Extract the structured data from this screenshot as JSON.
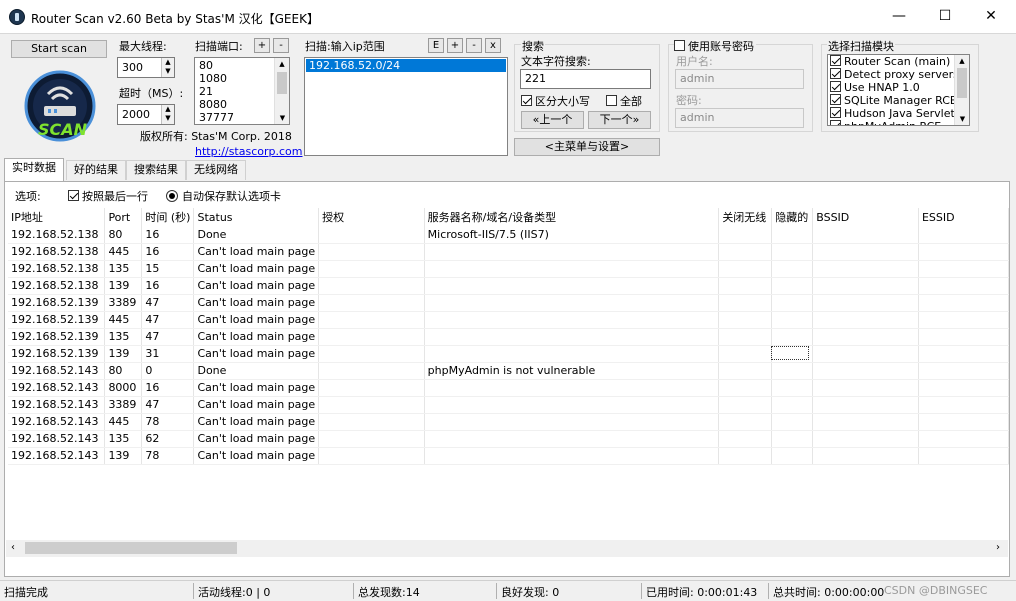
{
  "window": {
    "title": "Router Scan v2.60 Beta by Stas'M  汉化【GEEK】",
    "min": "—",
    "max": "☐",
    "close": "✕"
  },
  "controls": {
    "start_label": "Start scan",
    "threads_label": "最大线程:",
    "threads_value": "300",
    "timeout_label": "超时（MS）:",
    "timeout_value": "2000",
    "ports_label": "扫描端口:",
    "ports": [
      "80",
      "1080",
      "21",
      "8080",
      "37777"
    ],
    "ports_plus": "+",
    "ports_minus": "-",
    "copyright": "版权所有: Stas'M Corp. 2018",
    "link": "http://stascorp.com",
    "logo_text": "SCAN"
  },
  "ip_range": {
    "label": "扫描:输入ip范围",
    "btn_e": "E",
    "btn_plus": "+",
    "btn_minus": "-",
    "btn_x": "x",
    "items": [
      "192.168.52.0/24"
    ]
  },
  "search": {
    "group_label": "搜索",
    "text_label": "文本字符搜索:",
    "text_value": "221",
    "case_label": "区分大小写",
    "all_label": "全部",
    "prev_label": "«上一个",
    "next_label": "下一个»",
    "main_menu_label": "<主菜单与设置>"
  },
  "account": {
    "checkbox_label": "使用账号密码",
    "user_label": "用户名:",
    "user_value": "admin",
    "pass_label": "密码:",
    "pass_value": "admin"
  },
  "modules": {
    "label": "选择扫描模块",
    "items": [
      "Router Scan (main)",
      "Detect proxy servers",
      "Use HNAP 1.0",
      "SQLite Manager RCE",
      "Hudson Java Servlet",
      "phpMyAdmin RCE"
    ]
  },
  "tabs": [
    "实时数据",
    "好的结果",
    "搜索结果",
    "无线网络"
  ],
  "options": {
    "label": "选项:",
    "follow_label": "按照最后一行",
    "autosave_label": "自动保存默认选项卡"
  },
  "table": {
    "columns": [
      "IP地址",
      "Port",
      "时间 (秒)",
      "Status",
      "授权",
      "服务器名称/域名/设备类型",
      "关闭无线",
      "隐藏的",
      "BSSID",
      "ESSID"
    ],
    "rows": [
      [
        "192.168.52.138",
        "80",
        "16",
        "Done",
        "",
        "Microsoft-IIS/7.5 (IIS7)",
        "",
        "",
        "",
        ""
      ],
      [
        "192.168.52.138",
        "445",
        "16",
        "Can't load main page",
        "",
        "",
        "",
        "",
        "",
        ""
      ],
      [
        "192.168.52.138",
        "135",
        "15",
        "Can't load main page",
        "",
        "",
        "",
        "",
        "",
        ""
      ],
      [
        "192.168.52.138",
        "139",
        "16",
        "Can't load main page",
        "",
        "",
        "",
        "",
        "",
        ""
      ],
      [
        "192.168.52.139",
        "3389",
        "47",
        "Can't load main page",
        "",
        "",
        "",
        "",
        "",
        ""
      ],
      [
        "192.168.52.139",
        "445",
        "47",
        "Can't load main page",
        "",
        "",
        "",
        "",
        "",
        ""
      ],
      [
        "192.168.52.139",
        "135",
        "47",
        "Can't load main page",
        "",
        "",
        "",
        "",
        "",
        ""
      ],
      [
        "192.168.52.139",
        "139",
        "31",
        "Can't load main page",
        "",
        "",
        "",
        "",
        "",
        ""
      ],
      [
        "192.168.52.143",
        "80",
        "0",
        "Done",
        "",
        "phpMyAdmin is not vulnerable",
        "",
        "",
        "",
        ""
      ],
      [
        "192.168.52.143",
        "8000",
        "16",
        "Can't load main page",
        "",
        "",
        "",
        "",
        "",
        ""
      ],
      [
        "192.168.52.143",
        "3389",
        "47",
        "Can't load main page",
        "",
        "",
        "",
        "",
        "",
        ""
      ],
      [
        "192.168.52.143",
        "445",
        "78",
        "Can't load main page",
        "",
        "",
        "",
        "",
        "",
        ""
      ],
      [
        "192.168.52.143",
        "135",
        "62",
        "Can't load main page",
        "",
        "",
        "",
        "",
        "",
        ""
      ],
      [
        "192.168.52.143",
        "139",
        "78",
        "Can't load main page",
        "",
        "",
        "",
        "",
        "",
        ""
      ]
    ]
  },
  "status": {
    "state": "扫描完成",
    "threads": "活动线程:0 | 0",
    "found": "总发现数:14",
    "good": "良好发现:  0",
    "elapsed": "已用时间: 0:00:01:43",
    "total": "总共时间: 0:00:00:00",
    "watermark": "CSDN @DBINGSEC"
  }
}
